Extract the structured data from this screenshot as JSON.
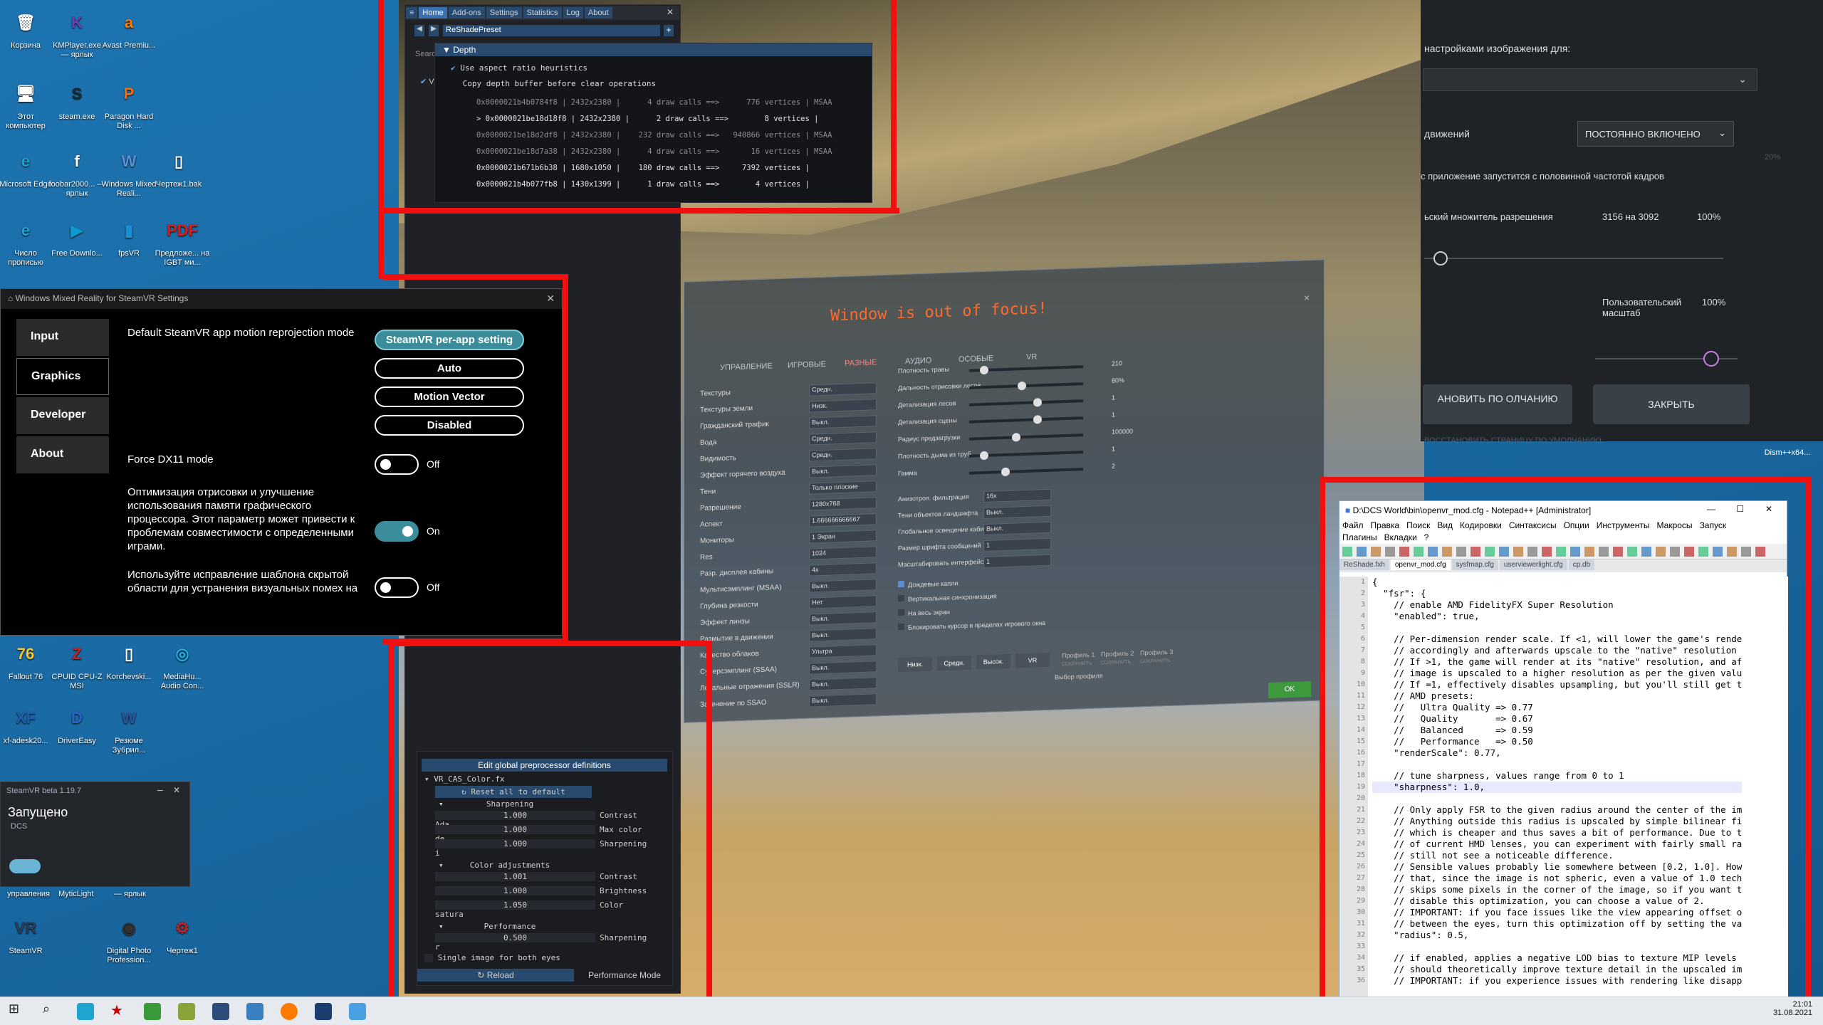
{
  "desktop": {
    "icons": [
      {
        "label": "Корзина",
        "glyph": "🗑",
        "color": "#ffffff"
      },
      {
        "label": "KMPlayer.exe — ярлык",
        "glyph": "K",
        "color": "#6a3fb0"
      },
      {
        "label": "Avast Premiu...",
        "glyph": "a",
        "color": "#ff7a00"
      },
      {
        "label": "Этот компьютер",
        "glyph": "🖥",
        "color": "#ffffff"
      },
      {
        "label": "steam.exe",
        "glyph": "S",
        "color": "#1b2838"
      },
      {
        "label": "Paragon Hard Disk ...",
        "glyph": "P",
        "color": "#ff6a00"
      },
      {
        "label": "Microsoft Edge",
        "glyph": "e",
        "color": "#1fa3d0"
      },
      {
        "label": "foobar2000... — ярлык",
        "glyph": "f",
        "color": "#ffffff"
      },
      {
        "label": "Windows Mixed Reali...",
        "glyph": "W",
        "color": "#5a8fd6"
      },
      {
        "label": "Чертеж1.bak",
        "glyph": "▯",
        "color": "#ffffff"
      },
      {
        "label": "Число прописью",
        "glyph": "e",
        "color": "#1fa3d0"
      },
      {
        "label": "Free Downlo...",
        "glyph": "▶",
        "color": "#0a9bd3"
      },
      {
        "label": "fpsVR",
        "glyph": "▮",
        "color": "#1a8fd6"
      },
      {
        "label": "Предложе... на IGBT ми...",
        "glyph": "PDF",
        "color": "#d21f1f"
      },
      {
        "label": "Fallout 76",
        "glyph": "76",
        "color": "#f4c62f"
      },
      {
        "label": "CPUID CPU-Z MSI",
        "glyph": "Z",
        "color": "#c91e1e"
      },
      {
        "label": "Korchevski...",
        "glyph": "▯",
        "color": "#ffffff"
      },
      {
        "label": "MediaHu... Audio Con...",
        "glyph": "◎",
        "color": "#1fb3e8"
      },
      {
        "label": "xf-adesk20...",
        "glyph": "XF",
        "color": "#1f5fa8"
      },
      {
        "label": "DriverEasy",
        "glyph": "D",
        "color": "#2b63c5"
      },
      {
        "label": "Резюме Зубрил...",
        "glyph": "W",
        "color": "#2b579a"
      },
      {
        "label": "SteamVR",
        "glyph": "VR",
        "color": "#2a3c55"
      },
      {
        "label": "Digital Photo Profession...",
        "glyph": "◉",
        "color": "#333333"
      },
      {
        "label": "Чертеж1",
        "glyph": "⚙",
        "color": "#bb2222"
      }
    ],
    "extra_labels": [
      "управления",
      "MyticLight",
      "— ярлык"
    ]
  },
  "reshade": {
    "tabs": [
      "Home",
      "Add-ons",
      "Settings",
      "Statistics",
      "Log",
      "About"
    ],
    "preset": "ReShadePreset",
    "search": "Search",
    "vr_label": "VR",
    "depth": {
      "header": "Depth",
      "options": [
        "Use aspect ratio heuristics",
        "Copy depth buffer before clear operations"
      ],
      "rows": [
        {
          "text": "0x0000021b4b0784f8 | 2432x2380 |      4 draw calls ==>      776 vertices | MSAA",
          "bright": false
        },
        {
          "text": "> 0x0000021be18d18f8 | 2432x2380 |      2 draw calls ==>        8 vertices |",
          "bright": true
        },
        {
          "text": "0x0000021be18d2df8 | 2432x2380 |    232 draw calls ==>   940866 vertices | MSAA",
          "bright": false
        },
        {
          "text": "0x0000021be18d7a38 | 2432x2380 |      4 draw calls ==>       16 vertices | MSAA",
          "bright": false
        },
        {
          "text": "0x0000021b671b6b38 | 1680x1050 |    180 draw calls ==>     7392 vertices |",
          "bright": true
        },
        {
          "text": "0x0000021b4b077fb8 | 1430x1399 |      1 draw calls ==>        4 vertices |",
          "bright": true
        }
      ]
    },
    "bottom": {
      "header": "Edit global preprocessor definitions",
      "file": "VR_CAS_Color.fx",
      "reset": "Reset all to default",
      "sec1": "Sharpening",
      "sec2": "Color adjustments",
      "sec3": "Performance",
      "params": [
        {
          "value": "1.000",
          "label": "Contrast Ada"
        },
        {
          "value": "1.000",
          "label": "Max color de"
        },
        {
          "value": "1.000",
          "label": "Sharpening i"
        },
        {
          "value": "1.001",
          "label": "Contrast"
        },
        {
          "value": "1.000",
          "label": "Brightness"
        },
        {
          "value": "1.050",
          "label": "Color satura"
        },
        {
          "value": "0.500",
          "label": "Sharpening r"
        }
      ],
      "single_image": "Single image for both eyes",
      "reload": "Reload",
      "perf_mode": "Performance Mode"
    }
  },
  "wmr": {
    "title": "Windows Mixed Reality for SteamVR Settings",
    "nav": [
      "Input",
      "Graphics",
      "Developer",
      "About"
    ],
    "reprojection_label": "Default SteamVR app motion reprojection mode",
    "reprojection_options": [
      "SteamVR per-app setting",
      "Auto",
      "Motion Vector",
      "Disabled"
    ],
    "dx11_label": "Force DX11 mode",
    "dx11_state": "Off",
    "opt_label": "Оптимизация отрисовки и улучшение использования памяти графического процессора. Этот параметр может привести к проблемам совместимости с определенными играми.",
    "opt_state": "On",
    "mask_label": "Используйте исправление шаблона скрытой области для устранения визуальных помех на",
    "mask_state": "Off"
  },
  "dcs": {
    "focus_msg": "Window is out of focus!",
    "tabs": [
      "УПРАВЛЕНИЕ",
      "ИГРОВЫЕ",
      "РАЗНЫЕ",
      "АУДИО",
      "ОСОБЫЕ",
      "VR"
    ],
    "left_rows": [
      {
        "label": "Текстуры",
        "value": "Средн."
      },
      {
        "label": "Текстуры земли",
        "value": "Низк."
      },
      {
        "label": "Гражданский трафик",
        "value": "Выкл."
      },
      {
        "label": "Вода",
        "value": "Средн."
      },
      {
        "label": "Видимость",
        "value": "Средн."
      },
      {
        "label": "Эффект горячего воздуха",
        "value": "Выкл."
      },
      {
        "label": "Тени",
        "value": "Только плоские"
      },
      {
        "label": "Разрешение",
        "value": "1280x768"
      },
      {
        "label": "Аспект",
        "value": "1.666666666667"
      },
      {
        "label": "Мониторы",
        "value": "1 Экран"
      },
      {
        "label": "Res",
        "value": "1024"
      },
      {
        "label": "Разр. дисплея кабины",
        "value": "4x"
      },
      {
        "label": "Мультисэмплинг (MSAA)",
        "value": "Выкл."
      },
      {
        "label": "Глубина резкости",
        "value": "Нет"
      },
      {
        "label": "Эффект линзы",
        "value": "Выкл."
      },
      {
        "label": "Размытие в движении",
        "value": "Выкл."
      },
      {
        "label": "Качество облаков",
        "value": "Ультра"
      },
      {
        "label": "Суперсэмплинг (SSAA)",
        "value": "Выкл."
      },
      {
        "label": "Локальные отражения (SSLR)",
        "value": "Выкл."
      },
      {
        "label": "Затенение по SSAO",
        "value": "Выкл."
      }
    ],
    "right_rows": [
      {
        "label": "Плотность травы",
        "value": "210"
      },
      {
        "label": "Дальность отрисовки лесов",
        "value": "80%"
      },
      {
        "label": "Детализация лесов",
        "value": "1"
      },
      {
        "label": "Детализация сцены",
        "value": "1"
      },
      {
        "label": "Радиус предзагрузки",
        "value": "100000"
      },
      {
        "label": "Плотность дыма из труб",
        "value": "1"
      },
      {
        "label": "Гамма",
        "value": "2"
      }
    ],
    "right_selects": [
      {
        "label": "Анизотроп. фильтрация",
        "value": "16x"
      },
      {
        "label": "Тени объектов ландшафта",
        "value": "Выкл."
      },
      {
        "label": "Глобальное освещение кабины",
        "value": "Выкл."
      },
      {
        "label": "Размер шрифта сообщений",
        "value": "1"
      },
      {
        "label": "Масштабировать интерфейс",
        "value": "1"
      }
    ],
    "checks": [
      "Дождевые капли",
      "Вертикальная синхронизация",
      "На весь экран",
      "Блокировать курсор в пределах игрового окна"
    ],
    "presets": [
      "Низк.",
      "Средн.",
      "Высок.",
      "VR"
    ],
    "profiles": [
      "Профиль 1",
      "Профиль 2",
      "Профиль 3"
    ],
    "save": "СОХРАНИТЬ",
    "profile_choice": "Выбор профиля",
    "ok": "OK"
  },
  "steamvr_mini": {
    "title": "SteamVR beta 1.19.7",
    "status": "Запущено",
    "sub": "DCS"
  },
  "nvpanel": {
    "line1": "настройками изображения для:",
    "motion_label": "движений",
    "motion_value": "ПОСТОЯННО ВКЛЮЧЕНО",
    "half_rate": "с приложение запустится с половинной частотой кадров",
    "res_label": "ьский множитель разрешения",
    "res_value": "3156 на 3092",
    "res_pct": "100%",
    "custom_label": "Пользовательский масштаб",
    "custom_pct": "100%",
    "restore_btn": "АНОВИТЬ ПО ОЛЧАНИЮ",
    "close_btn": "ЗАКРЫТЬ",
    "pct_right": "20%",
    "restore_link": "ВОССТАНОВИТЬ СТРАНИЦУ ПО УМОЛЧАНИЮ",
    "dism": "Dism++x64..."
  },
  "notepad": {
    "title": "D:\\DCS World\\bin\\openvr_mod.cfg - Notepad++ [Administrator]",
    "menu": [
      "Файл",
      "Правка",
      "Поиск",
      "Вид",
      "Кодировки",
      "Синтаксисы",
      "Опции",
      "Инструменты",
      "Макросы",
      "Запуск"
    ],
    "menu2": [
      "Плагины",
      "Вкладки",
      "?"
    ],
    "tabs": [
      "ReShade.fxh",
      "openvr_mod.cfg",
      "sysfmap.cfg",
      "userviewerlight.cfg",
      "cp.db"
    ],
    "active_tab": 1,
    "highlight_line": 19,
    "lines": [
      "{",
      "  \"fsr\": {",
      "    // enable AMD FidelityFX Super Resolution",
      "    \"enabled\": true,",
      "",
      "    // Per-dimension render scale. If <1, will lower the game's rende",
      "    // accordingly and afterwards upscale to the \"native\" resolution",
      "    // If >1, the game will render at its \"native\" resolution, and af",
      "    // image is upscaled to a higher resolution as per the given valu",
      "    // If =1, effectively disables upsampling, but you'll still get t",
      "    // AMD presets:",
      "    //   Ultra Quality => 0.77",
      "    //   Quality       => 0.67",
      "    //   Balanced      => 0.59",
      "    //   Performance   => 0.50",
      "    \"renderScale\": 0.77,",
      "",
      "    // tune sharpness, values range from 0 to 1",
      "    \"sharpness\": 1.0,",
      "",
      "    // Only apply FSR to the given radius around the center of the im",
      "    // Anything outside this radius is upscaled by simple bilinear fi",
      "    // which is cheaper and thus saves a bit of performance. Due to t",
      "    // of current HMD lenses, you can experiment with fairly small ra",
      "    // still not see a noticeable difference.",
      "    // Sensible values probably lie somewhere between [0.2, 1.0]. How",
      "    // that, since the image is not spheric, even a value of 1.0 tech",
      "    // skips some pixels in the corner of the image, so if you want t",
      "    // disable this optimization, you can choose a value of 2.",
      "    // IMPORTANT: if you face issues like the view appearing offset o",
      "    // between the eyes, turn this optimization off by setting the va",
      "    \"radius\": 0.5,",
      "",
      "    // if enabled, applies a negative LOD bias to texture MIP levels",
      "    // should theoretically improve texture detail in the upscaled im",
      "    // IMPORTANT: if you experience issues with rendering like disapp"
    ]
  },
  "taskbar": {
    "time": "21:01",
    "date": "31.08.2021"
  },
  "colors": {
    "highlight_red": "#f01010",
    "accent_teal": "#3c8d9c"
  }
}
